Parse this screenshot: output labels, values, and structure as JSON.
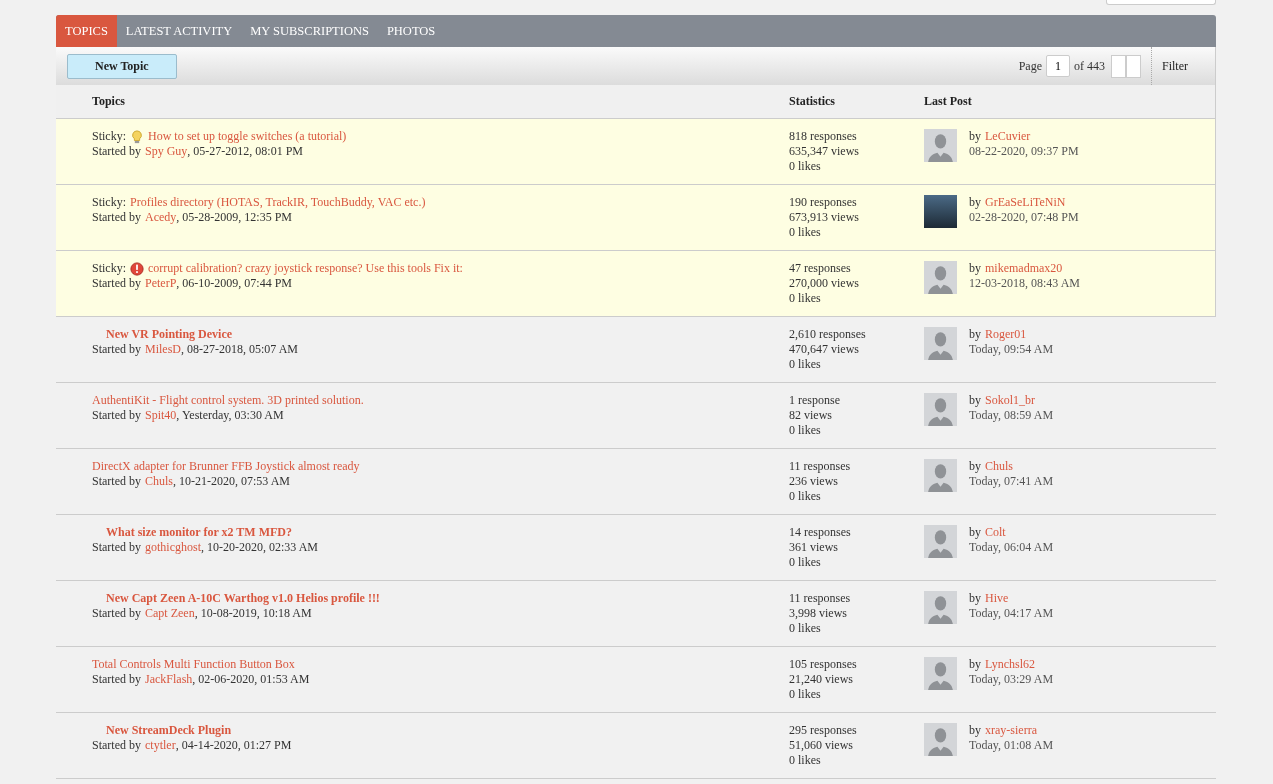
{
  "tabs": [
    {
      "label": "TOPICS",
      "selected": true
    },
    {
      "label": "LATEST ACTIVITY",
      "selected": false
    },
    {
      "label": "MY SUBSCRIPTIONS",
      "selected": false
    },
    {
      "label": "PHOTOS",
      "selected": false
    }
  ],
  "toolbar": {
    "new_topic": "New Topic",
    "page_label": "Page",
    "page_value": "1",
    "page_total": "of 443",
    "filter": "Filter"
  },
  "columns": [
    "Topics",
    "Statistics",
    "Last Post"
  ],
  "rows": [
    {
      "sticky": true,
      "prefix": "Sticky:",
      "kind": "idea",
      "unread": false,
      "title": "How to set up toggle switches (a tutorial)",
      "started": "Started by",
      "author": "Spy Guy",
      "date": ", 05-27-2012, 08:01 PM",
      "responses": "818 responses",
      "views": "635,347 views",
      "likes": "0 likes",
      "has_photo": false,
      "by": "by",
      "last_user": "LeCuvier",
      "last_date": "08-22-2020, 09:37 PM"
    },
    {
      "sticky": true,
      "prefix": "Sticky:",
      "kind": "plain",
      "unread": false,
      "title": "Profiles directory (HOTAS, TrackIR, TouchBuddy, VAC etc.)",
      "started": "Started by",
      "author": "Acedy",
      "date": ", 05-28-2009, 12:35 PM",
      "responses": "190 responses",
      "views": "673,913 views",
      "likes": "0 likes",
      "has_photo": true,
      "by": "by",
      "last_user": "GrEaSeLiTeNiN",
      "last_date": "02-28-2020, 07:48 PM"
    },
    {
      "sticky": true,
      "prefix": "Sticky:",
      "kind": "alert",
      "unread": false,
      "title": "corrupt calibration? crazy joystick response? Use this tools Fix it:",
      "started": "Started by",
      "author": "PeterP",
      "date": ", 06-10-2009, 07:44 PM",
      "responses": "47 responses",
      "views": "270,000 views",
      "likes": "0 likes",
      "has_photo": false,
      "by": "by",
      "last_user": "mikemadmax20",
      "last_date": "12-03-2018, 08:43 AM"
    },
    {
      "sticky": false,
      "kind": "plain",
      "unread": true,
      "title": "New VR Pointing Device",
      "started": "Started by",
      "author": "MilesD",
      "date": ", 08-27-2018, 05:07 AM",
      "responses": "2,610 responses",
      "views": "470,647 views",
      "likes": "0 likes",
      "has_photo": false,
      "by": "by",
      "last_user": "Roger01",
      "last_date": "Today, 09:54 AM"
    },
    {
      "sticky": false,
      "kind": "plain",
      "unread": false,
      "title": "AuthentiKit - Flight control system. 3D printed solution.",
      "started": "Started by",
      "author": "Spit40",
      "date": ", Yesterday, 03:30 AM",
      "responses": "1 response",
      "views": "82 views",
      "likes": "0 likes",
      "has_photo": false,
      "by": "by",
      "last_user": "Sokol1_br",
      "last_date": "Today, 08:59 AM"
    },
    {
      "sticky": false,
      "kind": "plain",
      "unread": false,
      "title": "DirectX adapter for Brunner FFB Joystick almost ready",
      "started": "Started by",
      "author": "Chuls",
      "date": ", 10-21-2020, 07:53 AM",
      "responses": "11 responses",
      "views": "236 views",
      "likes": "0 likes",
      "has_photo": false,
      "by": "by",
      "last_user": "Chuls",
      "last_date": "Today, 07:41 AM"
    },
    {
      "sticky": false,
      "kind": "plain",
      "unread": true,
      "title": "What size monitor for x2 TM MFD?",
      "started": "Started by",
      "author": "gothicghost",
      "date": ", 10-20-2020, 02:33 AM",
      "responses": "14 responses",
      "views": "361 views",
      "likes": "0 likes",
      "has_photo": false,
      "by": "by",
      "last_user": "Colt",
      "last_date": "Today, 06:04 AM"
    },
    {
      "sticky": false,
      "kind": "plain",
      "unread": true,
      "title": "New Capt Zeen A-10C Warthog v1.0 Helios profile !!!",
      "started": "Started by",
      "author": "Capt Zeen",
      "date": ", 10-08-2019, 10:18 AM",
      "responses": "11 responses",
      "views": "3,998 views",
      "likes": "0 likes",
      "has_photo": false,
      "by": "by",
      "last_user": "Hive",
      "last_date": "Today, 04:17 AM"
    },
    {
      "sticky": false,
      "kind": "plain",
      "unread": false,
      "title": "Total Controls Multi Function Button Box",
      "started": "Started by",
      "author": "JackFlash",
      "date": ", 02-06-2020, 01:53 AM",
      "responses": "105 responses",
      "views": "21,240 views",
      "likes": "0 likes",
      "has_photo": false,
      "by": "by",
      "last_user": "Lynchsl62",
      "last_date": "Today, 03:29 AM"
    },
    {
      "sticky": false,
      "kind": "plain",
      "unread": true,
      "title": "New StreamDeck Plugin",
      "started": "Started by",
      "author": "ctytler",
      "date": ", 04-14-2020, 01:27 PM",
      "responses": "295 responses",
      "views": "51,060 views",
      "likes": "0 likes",
      "has_photo": false,
      "by": "by",
      "last_user": "xray-sierra",
      "last_date": "Today, 01:08 AM"
    }
  ]
}
